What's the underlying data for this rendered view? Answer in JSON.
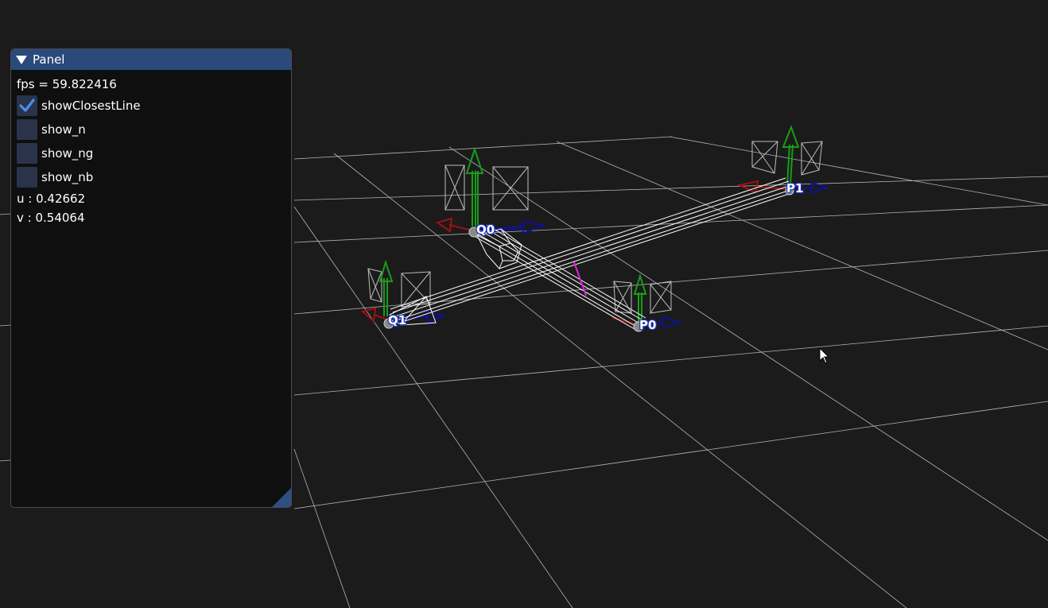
{
  "panel": {
    "title": "Panel",
    "fps_text": "fps = 59.822416",
    "checkboxes": [
      {
        "label": "showClosestLine",
        "checked": true
      },
      {
        "label": "show_n",
        "checked": false
      },
      {
        "label": "show_ng",
        "checked": false
      },
      {
        "label": "show_nb",
        "checked": false
      }
    ],
    "u_text": "u : 0.42662",
    "v_text": "v : 0.54064"
  },
  "scene": {
    "point_labels": {
      "p0": "P0",
      "p1": "P1",
      "q0": "Q0",
      "q1": "Q1"
    }
  },
  "colors": {
    "background": "#1b1b1b",
    "grid": "#cfcfcf",
    "title_bar": "#294a7a",
    "checkbox": "#29344a",
    "checkmark": "#4a90e8",
    "axis_x": "#a01010",
    "axis_y": "#1a9c1a",
    "axis_z": "#101096",
    "closest_line": "#e020e0"
  },
  "icons": {
    "collapse": "triangle-down-icon",
    "check": "checkmark-icon",
    "resize": "resize-grip-icon",
    "cursor": "mouse-pointer-icon"
  }
}
